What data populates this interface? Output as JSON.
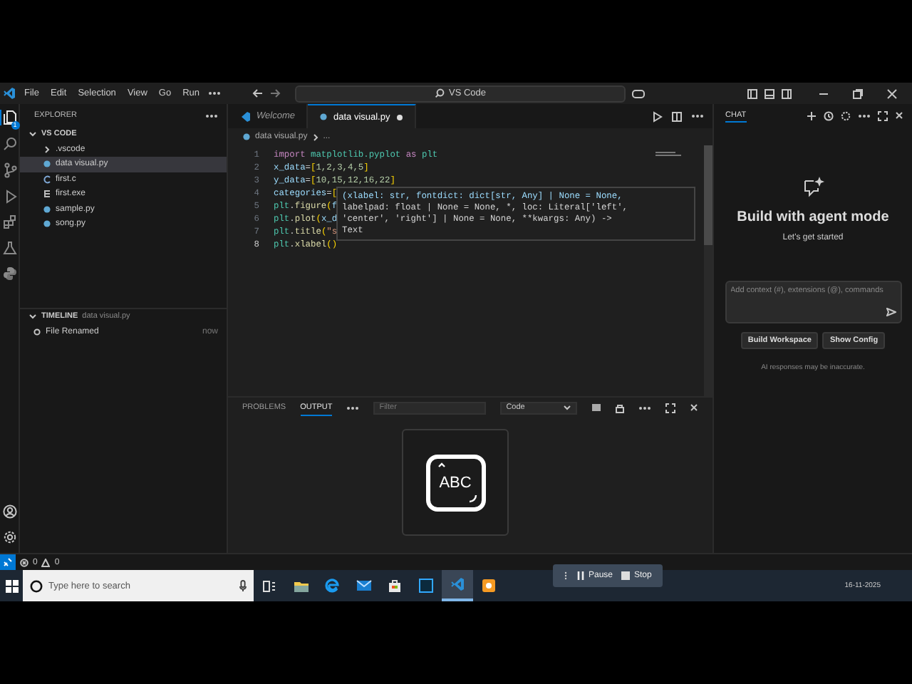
{
  "title_bar": {
    "menu": [
      "File",
      "Edit",
      "Selection",
      "View",
      "Go",
      "Run"
    ],
    "search": "VS Code"
  },
  "activity_bar": {
    "items": [
      {
        "kind": "explorer",
        "selected": true,
        "badge": "1"
      },
      {
        "kind": "search",
        "selected": false
      },
      {
        "kind": "source_control",
        "selected": false
      },
      {
        "kind": "run",
        "selected": false
      },
      {
        "kind": "extensions",
        "selected": false
      },
      {
        "kind": "testing",
        "selected": false
      },
      {
        "kind": "python",
        "selected": false
      }
    ]
  },
  "explorer": {
    "title": "EXPLORER",
    "folder": {
      "label": "VS CODE",
      "expanded": true,
      "children": [
        {
          "label": ".vscode",
          "kind": "folder",
          "expanded": false,
          "selected": false
        },
        {
          "label": "data visual.py",
          "kind": "python",
          "selected": true
        },
        {
          "label": "first.c",
          "kind": "c",
          "selected": false
        },
        {
          "label": "first.exe",
          "kind": "exe",
          "selected": false
        },
        {
          "label": "sample.py",
          "kind": "python",
          "selected": false
        },
        {
          "label": "song.py",
          "kind": "python",
          "selected": false
        }
      ]
    },
    "timeline": {
      "title": "TIMELINE",
      "file": "data visual.py",
      "expanded": true,
      "items": [
        {
          "label": "File Renamed",
          "time": "now"
        }
      ]
    }
  },
  "editor": {
    "tabs": [
      {
        "label": "Welcome",
        "kind": "welcome",
        "selected": false,
        "modified": false
      },
      {
        "label": "data visual.py",
        "kind": "python",
        "selected": true,
        "modified": true
      }
    ],
    "breadcrumb": [
      "data visual.py",
      "..."
    ],
    "lines": [
      {
        "number": "1",
        "tokens": [
          {
            "text": "import",
            "kind": "keyword"
          },
          {
            "text": " matplotlib.pyplot ",
            "kind": "module"
          },
          {
            "text": "as",
            "kind": "keyword"
          },
          {
            "text": " plt",
            "kind": "module"
          }
        ]
      },
      {
        "number": "2",
        "tokens": [
          {
            "text": "x_data",
            "kind": "variable"
          },
          {
            "text": "=",
            "kind": "plain"
          },
          {
            "text": "[",
            "kind": "bracket"
          },
          {
            "text": "1,2,3,4,5",
            "kind": "number"
          },
          {
            "text": "]",
            "kind": "bracket"
          }
        ]
      },
      {
        "number": "3",
        "tokens": [
          {
            "text": "y_data",
            "kind": "variable"
          },
          {
            "text": "=",
            "kind": "plain"
          },
          {
            "text": "[",
            "kind": "bracket"
          },
          {
            "text": "10,15,12,16,22",
            "kind": "number"
          },
          {
            "text": "]",
            "kind": "bracket"
          }
        ]
      },
      {
        "number": "4",
        "tokens": [
          {
            "text": "categories",
            "kind": "variable"
          },
          {
            "text": "=",
            "kind": "plain"
          },
          {
            "text": "[",
            "kind": "bracket"
          }
        ]
      },
      {
        "number": "5",
        "tokens": [
          {
            "text": "plt",
            "kind": "module"
          },
          {
            "text": ".",
            "kind": "plain"
          },
          {
            "text": "figure",
            "kind": "func"
          },
          {
            "text": "(",
            "kind": "bracket"
          },
          {
            "text": "f",
            "kind": "variable"
          }
        ]
      },
      {
        "number": "6",
        "tokens": [
          {
            "text": "plt",
            "kind": "module"
          },
          {
            "text": ".",
            "kind": "plain"
          },
          {
            "text": "plot",
            "kind": "func"
          },
          {
            "text": "(",
            "kind": "bracket"
          },
          {
            "text": "x_d",
            "kind": "variable"
          }
        ]
      },
      {
        "number": "7",
        "tokens": [
          {
            "text": "plt",
            "kind": "module"
          },
          {
            "text": ".",
            "kind": "plain"
          },
          {
            "text": "title",
            "kind": "func"
          },
          {
            "text": "(",
            "kind": "bracket"
          },
          {
            "text": "\"s",
            "kind": "string"
          }
        ]
      },
      {
        "number": "8",
        "tokens": [
          {
            "text": "plt",
            "kind": "module"
          },
          {
            "text": ".",
            "kind": "plain"
          },
          {
            "text": "xlabel",
            "kind": "func"
          },
          {
            "text": "()",
            "kind": "bracket"
          }
        ]
      }
    ],
    "hover": [
      "(xlabel: str, fontdict: dict[str, Any] | None = None,",
      "labelpad: float | None = None, *, loc: Literal['left',",
      "'center', 'right'] | None = None, **kwargs: Any) ->",
      "Text"
    ]
  },
  "panel": {
    "tabs": [
      {
        "label": "PROBLEMS",
        "selected": false
      },
      {
        "label": "OUTPUT",
        "selected": true
      }
    ],
    "filter": {
      "placeholder": "Filter"
    },
    "channel": "Code",
    "popup": "ABC"
  },
  "chat": {
    "title": "CHAT",
    "heading": "Build with agent mode",
    "subheading": "Let's get started",
    "input": {
      "placeholder": "Add context (#), extensions (@), commands"
    },
    "buttons": [
      "Build Workspace",
      "Show Config"
    ],
    "disclaimer": "AI responses may be inaccurate."
  },
  "status_bar": {
    "errors": "0",
    "warnings": "0"
  },
  "taskbar": {
    "search": {
      "placeholder": "Type here to search"
    },
    "apps": [
      {
        "kind": "task_view",
        "selected": false
      },
      {
        "kind": "files",
        "selected": false
      },
      {
        "kind": "browser",
        "selected": false
      },
      {
        "kind": "mail",
        "selected": false
      },
      {
        "kind": "store",
        "selected": false
      },
      {
        "kind": "photo_editor",
        "selected": false
      },
      {
        "kind": "code",
        "selected": true
      },
      {
        "kind": "recorder",
        "selected": false
      }
    ],
    "recorder": [
      "Pause",
      "Stop"
    ],
    "date": "16-11-2025"
  }
}
